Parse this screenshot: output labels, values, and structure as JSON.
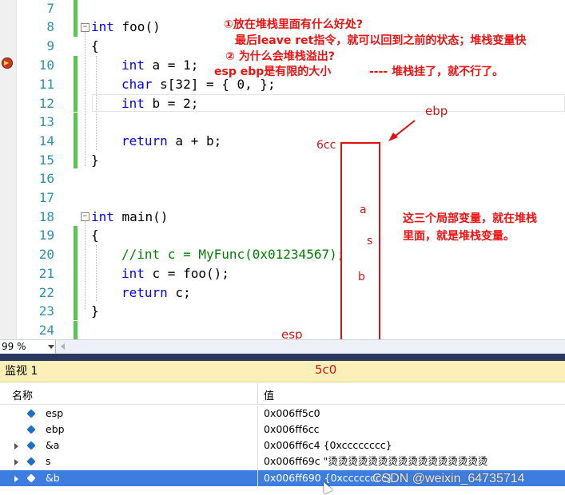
{
  "line_numbers": [
    "7",
    "8",
    "9",
    "10",
    "11",
    "12",
    "13",
    "14",
    "15",
    "16",
    "17",
    "18",
    "19",
    "20",
    "21",
    "22",
    "23",
    "24"
  ],
  "code": {
    "l8_kw": "int",
    "l8_rest": " foo()",
    "l9": "{",
    "l10_kw": "int",
    "l10_rest": " a = 1;",
    "l11_kw": "char",
    "l11_rest": " s[32] = { 0, };",
    "l12_kw": "int",
    "l12_rest": " b = 2;",
    "l14_kw": "return",
    "l14_rest": " a + b;",
    "l15": "}",
    "l18_kw": "int",
    "l18_rest": " main()",
    "l19": "{",
    "l20": "//int c = MyFunc(0x01234567);",
    "l21_kw": "int",
    "l21_rest": " c = foo();",
    "l22_kw": "return",
    "l22_rest": " c;",
    "l23": "}",
    "fold_symbol": "−"
  },
  "annotations": {
    "q1": "①放在堆栈里面有什么好处?",
    "q1_answer": "最后leave ret指令，就可以回到之前的状态；堆栈变量快",
    "q2": "② 为什么会堆栈溢出?",
    "q2_answer": "esp ebp是有限的大小",
    "q2_answer2": "---- 堆栈挂了，就不行了。",
    "ebp": "ebp",
    "addr_top": "6cc",
    "var_a": "a",
    "var_s": "s",
    "var_b": "b",
    "explain": "这三个局部变量，就在堆栈",
    "explain2": "里面，就是堆栈变量。",
    "esp": "esp",
    "addr_bottom": "5c0",
    "color": "#e01010"
  },
  "zoom": "99 %",
  "watch": {
    "title": "监视 1",
    "col_name": "名称",
    "col_value": "值",
    "rows": [
      {
        "name": "esp",
        "value": "0x006ff5c0",
        "expandable": false,
        "selected": false
      },
      {
        "name": "ebp",
        "value": "0x006ff6cc",
        "expandable": false,
        "selected": false
      },
      {
        "name": "&a",
        "value": "0x006ff6c4 {0xcccccccc}",
        "expandable": true,
        "selected": false
      },
      {
        "name": "s",
        "value": "0x006ff69c \"烫烫烫烫烫烫烫烫烫烫烫烫烫烫烫烫",
        "expandable": true,
        "selected": false
      },
      {
        "name": "&b",
        "value": "0x006ff690 {0xcccccccc}",
        "expandable": true,
        "selected": true
      }
    ]
  },
  "watermark": "CSDN @weixin_64735714",
  "colors": {
    "keyword": "#0000ff",
    "comment": "#008000",
    "line_number": "#2b91af",
    "selection": "#3d7de0",
    "watch_title_bg": "#fcf0b8"
  }
}
